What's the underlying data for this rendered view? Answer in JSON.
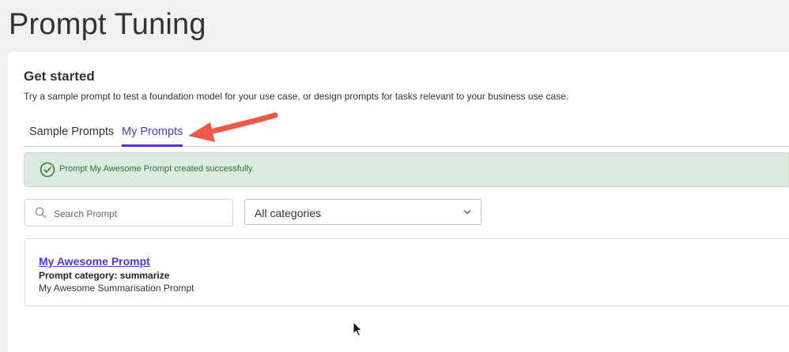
{
  "page": {
    "title": "Prompt Tuning"
  },
  "section": {
    "title": "Get started",
    "description": "Try a sample prompt to test a foundation model for your use case, or design prompts for tasks relevant to your business use case."
  },
  "tabs": [
    {
      "label": "Sample Prompts",
      "active": false
    },
    {
      "label": "My Prompts",
      "active": true
    }
  ],
  "alert": {
    "message": "Prompt My Awesome Prompt created successfully.",
    "icon": "check-circle-icon",
    "color": "#2f6d3a"
  },
  "search": {
    "placeholder": "Search Prompt",
    "value": "",
    "icon": "search-icon"
  },
  "category_filter": {
    "selected": "All categories",
    "icon": "chevron-down-icon"
  },
  "prompts": [
    {
      "name": "My Awesome Prompt",
      "category_line": "Prompt category: summarize",
      "description": "My Awesome Summarisation Prompt"
    }
  ],
  "colors": {
    "accent": "#4b38d6",
    "alert_bg": "#dcebdf",
    "annotation_arrow": "#ee5a4a"
  }
}
